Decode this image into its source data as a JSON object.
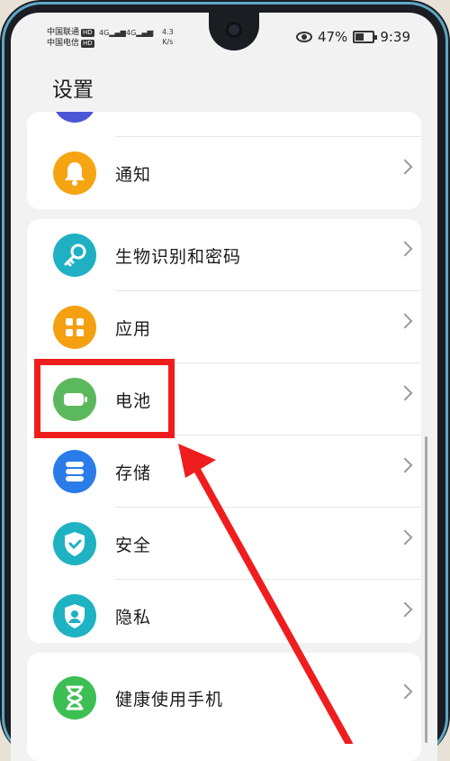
{
  "status_bar": {
    "carrier_1": "中国联通",
    "carrier_2": "中国电信",
    "hd_badge": "HD",
    "network_1": "4G",
    "network_2": "4G",
    "speed_value": "4.3",
    "speed_unit": "K/s",
    "battery_percent": "47%",
    "time": "9:39"
  },
  "header": {
    "title": "设置"
  },
  "settings": {
    "items": [
      {
        "label": "",
        "icon": "partial-icon",
        "color": "#4a56d6"
      },
      {
        "label": "通知",
        "icon": "bell-icon",
        "color": "#f5a511"
      },
      {
        "label": "生物识别和密码",
        "icon": "key-icon",
        "color": "#1fb0c4"
      },
      {
        "label": "应用",
        "icon": "apps-grid-icon",
        "color": "#f5a011"
      },
      {
        "label": "电池",
        "icon": "battery-icon",
        "color": "#5cb85c"
      },
      {
        "label": "存储",
        "icon": "storage-icon",
        "color": "#2a7ce8"
      },
      {
        "label": "安全",
        "icon": "shield-check-icon",
        "color": "#1eb2c2"
      },
      {
        "label": "隐私",
        "icon": "privacy-icon",
        "color": "#1eb2c2"
      },
      {
        "label": "健康使用手机",
        "icon": "hourglass-icon",
        "color": "#3dbf53"
      }
    ]
  },
  "annotation": {
    "highlight_color": "#ef1d1d"
  }
}
